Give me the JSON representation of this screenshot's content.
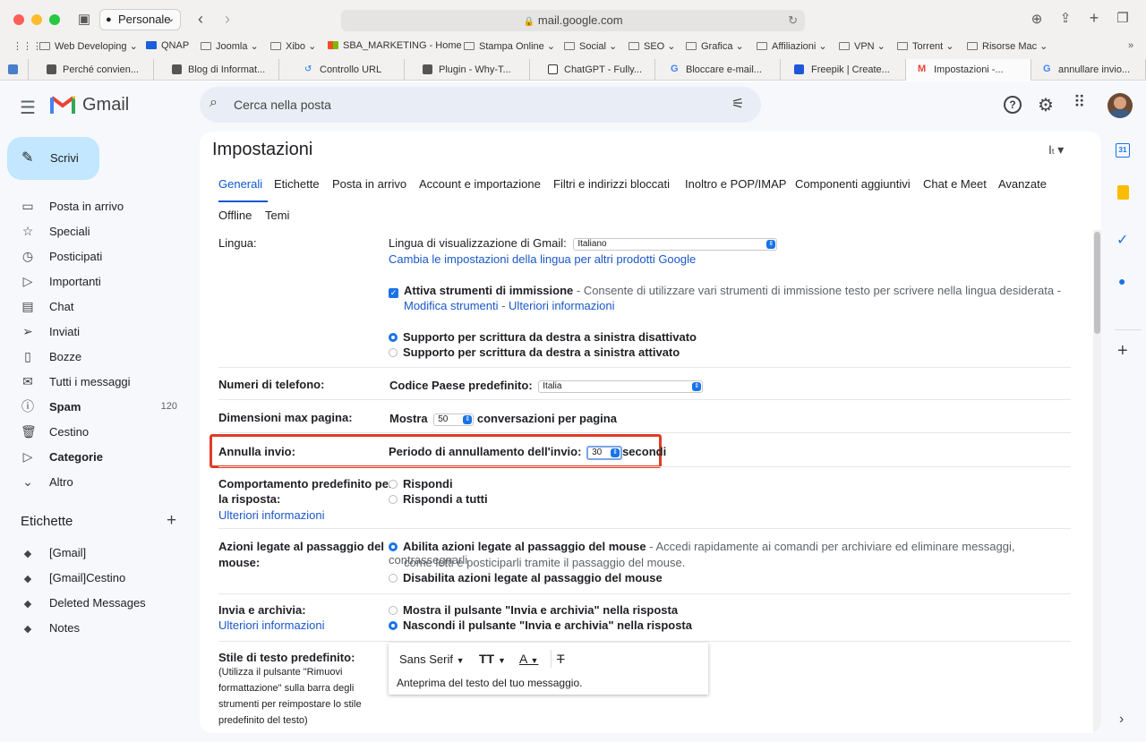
{
  "browser": {
    "profile": "Personale",
    "url": "mail.google.com",
    "bookmarks": [
      "Web Developing",
      "QNAP",
      "Joomla",
      "Xibo",
      "SBA_MARKETING - Home",
      "Stampa Online",
      "Social",
      "SEO",
      "Grafica",
      "Affiliazioni",
      "VPN",
      "Torrent",
      "Risorse Mac"
    ],
    "tabs": [
      "Perché convien...",
      "Blog di Informat...",
      "Controllo URL",
      "Plugin - Why-T...",
      "ChatGPT - Fully...",
      "Bloccare e-mail...",
      "Freepik | Create...",
      "Impostazioni -...",
      "annullare invio..."
    ]
  },
  "gmail": {
    "logo": "Gmail",
    "search_placeholder": "Cerca nella posta",
    "compose": "Scrivi",
    "nav": [
      {
        "label": "Posta in arrivo",
        "icon": "inbox-icon",
        "glyph": "▭"
      },
      {
        "label": "Speciali",
        "icon": "star-icon",
        "glyph": "☆"
      },
      {
        "label": "Posticipati",
        "icon": "clock-icon",
        "glyph": "◷"
      },
      {
        "label": "Importanti",
        "icon": "important-icon",
        "glyph": "▷"
      },
      {
        "label": "Chat",
        "icon": "chat-icon",
        "glyph": "▤"
      },
      {
        "label": "Inviati",
        "icon": "send-icon",
        "glyph": "➢"
      },
      {
        "label": "Bozze",
        "icon": "draft-icon",
        "glyph": "▯"
      },
      {
        "label": "Tutti i messaggi",
        "icon": "all-mail-icon",
        "glyph": "✉"
      },
      {
        "label": "Spam",
        "icon": "spam-icon",
        "glyph": "ⓘ",
        "count": "120"
      },
      {
        "label": "Cestino",
        "icon": "trash-icon",
        "glyph": "🗑"
      },
      {
        "label": "Categorie",
        "icon": "label-icon",
        "glyph": "▷"
      },
      {
        "label": "Altro",
        "icon": "chevron-down-icon",
        "glyph": "⌄"
      }
    ],
    "labels_title": "Etichette",
    "labels": [
      "[Gmail]",
      "[Gmail]Cestino",
      "Deleted Messages",
      "Notes"
    ]
  },
  "settings": {
    "title": "Impostazioni",
    "tabs_row1": [
      "Generali",
      "Etichette",
      "Posta in arrivo",
      "Account e importazione",
      "Filtri e indirizzi bloccati",
      "Inoltro e POP/IMAP",
      "Componenti aggiuntivi",
      "Chat e Meet",
      "Avanzate"
    ],
    "tabs_row2": [
      "Offline",
      "Temi"
    ],
    "lingua": {
      "label": "Lingua:",
      "display": "Lingua di visualizzazione di Gmail:",
      "display_value": "Italiano",
      "change_link": "Cambia le impostazioni della lingua per altri prodotti Google",
      "input_tools": "Attiva strumenti di immissione",
      "input_tools_desc": " - Consente di utilizzare vari strumenti di immissione testo per scrivere nella lingua desiderata -",
      "modify_link": "Modifica strumenti",
      "sep": " - ",
      "more_link": "Ulteriori informazioni",
      "rtl_off": "Supporto per scrittura da destra a sinistra disattivato",
      "rtl_on": "Supporto per scrittura da destra a sinistra attivato"
    },
    "phone": {
      "label": "Numeri di telefono:",
      "text": "Codice Paese predefinito:",
      "value": "Italia"
    },
    "pagesize": {
      "label": "Dimensioni max pagina:",
      "show": "Mostra",
      "value": "50",
      "suffix": "conversazioni per pagina"
    },
    "undo": {
      "label": "Annulla invio:",
      "text": "Periodo di annullamento dell'invio:",
      "value": "30",
      "suffix": "secondi",
      "highlight_color": "#e03b24"
    },
    "reply": {
      "label1": "Comportamento predefinito per",
      "label2": "la risposta:",
      "link": "Ulteriori informazioni",
      "opt1": "Rispondi",
      "opt2": "Rispondi a tutti"
    },
    "hover": {
      "label1": "Azioni legate al passaggio del",
      "label2": "mouse:",
      "opt1": "Abilita azioni legate al passaggio del mouse",
      "opt1_desc": " - Accedi rapidamente ai comandi per archiviare ed eliminare messaggi, contrassegnarli",
      "opt1_desc2": "come letti e posticiparli tramite il passaggio del mouse.",
      "opt2": "Disabilita azioni legate al passaggio del mouse"
    },
    "sendarchive": {
      "label": "Invia e archivia:",
      "link": "Ulteriori informazioni",
      "opt1": "Mostra il pulsante \"Invia e archivia\" nella risposta",
      "opt2": "Nascondi il pulsante \"Invia e archivia\" nella risposta"
    },
    "textstyle": {
      "label": "Stile di testo predefinito:",
      "desc1": "(Utilizza il pulsante \"Rimuovi",
      "desc2": "formattazione\" sulla barra degli",
      "desc3": "strumenti per reimpostare lo stile",
      "desc4": "predefinito del testo)",
      "font": "Sans Serif",
      "preview": "Anteprima del testo del tuo messaggio."
    }
  }
}
